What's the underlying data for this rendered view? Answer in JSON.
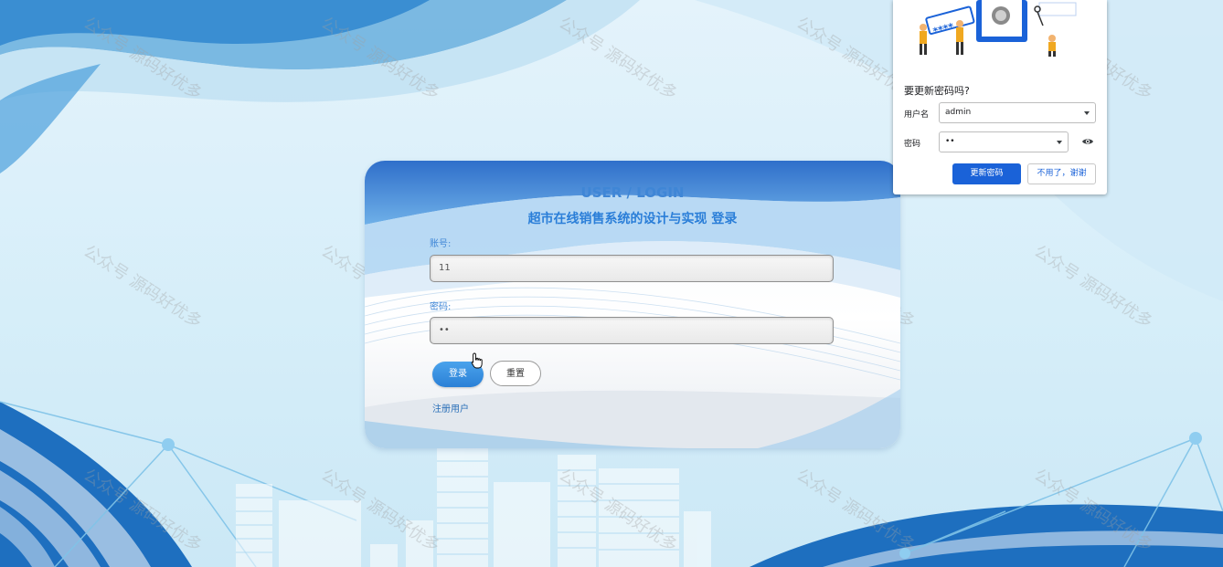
{
  "watermark_text": "公众号 源码好优多",
  "login": {
    "heading": "USER / LOGIN",
    "title": "超市在线销售系统的设计与实现 登录",
    "account_label": "账号:",
    "account_value": "11",
    "password_label": "密码:",
    "password_value": "••",
    "login_button": "登录",
    "reset_button": "重置",
    "register_link": "注册用户"
  },
  "password_prompt": {
    "title": "要更新密码吗?",
    "username_label": "用户名",
    "username_value": "admin",
    "password_label": "密码",
    "password_value": "••",
    "update_button": "更新密码",
    "decline_button": "不用了，谢谢",
    "illustration_masked_text": "****",
    "icons": {
      "show_password": "eye-icon",
      "dropdown": "chevron-down-icon",
      "cursor": "hand-pointer-icon"
    }
  },
  "colors": {
    "accent_blue": "#2b80d6",
    "chrome_blue": "#1a62d8",
    "title_blue": "#2a7ed8"
  }
}
